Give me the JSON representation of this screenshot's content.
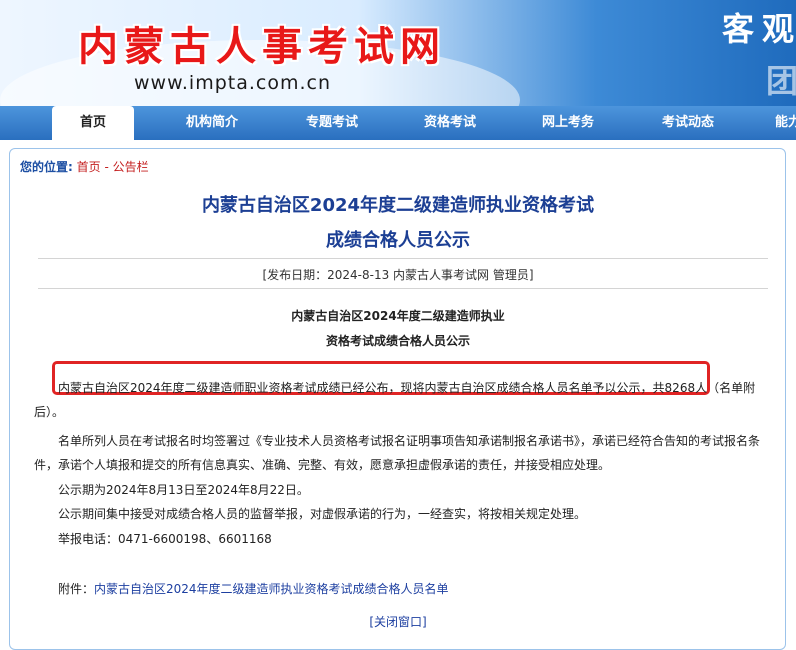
{
  "header": {
    "site_title": "内蒙古人事考试网",
    "site_url": "www.impta.com.cn",
    "slogan_1": "客观",
    "slogan_2": "团"
  },
  "nav": {
    "items": [
      {
        "label": "首页",
        "active": true
      },
      {
        "label": "机构简介"
      },
      {
        "label": "专题考试"
      },
      {
        "label": "资格考试"
      },
      {
        "label": "网上考务"
      },
      {
        "label": "考试动态"
      },
      {
        "label": "能力"
      }
    ]
  },
  "breadcrumb": {
    "label": "您的位置:",
    "home": "首页",
    "separator": " - ",
    "current": "公告栏"
  },
  "article": {
    "title_line1": "内蒙古自治区2024年度二级建造师执业资格考试",
    "title_line2": "成绩合格人员公示",
    "publish_info": "[发布日期：2024-8-13 内蒙古人事考试网 管理员]",
    "subtitle_line1": "内蒙古自治区2024年度二级建造师执业",
    "subtitle_line2": "资格考试成绩合格人员公示",
    "para1": "内蒙古自治区2024年度二级建造师职业资格考试成绩已经公布，现将内蒙古自治区成绩合格人员名单予以公示，共8268人（名单附后）。",
    "para2": "名单所列人员在考试报名时均签署过《专业技术人员资格考试报名证明事项告知承诺制报名承诺书》，承诺已经符合告知的考试报名条件，承诺个人填报和提交的所有信息真实、准确、完整、有效，愿意承担虚假承诺的责任，并接受相应处理。",
    "para3": "公示期为2024年8月13日至2024年8月22日。",
    "para4": "公示期间集中接受对成绩合格人员的监督举报，对虚假承诺的行为，一经查实，将按相关规定处理。",
    "para5": "举报电话：0471-6600198、6601168",
    "attachment_label": "附件：",
    "attachment_link": "内蒙古自治区2024年度二级建造师执业资格考试成绩合格人员名单",
    "close_window": "[关闭窗口]"
  },
  "colors": {
    "nav_blue": "#2a6fbf",
    "title_blue": "#1c3f94",
    "highlight_red": "#e02424",
    "site_title_red": "#e81818"
  }
}
